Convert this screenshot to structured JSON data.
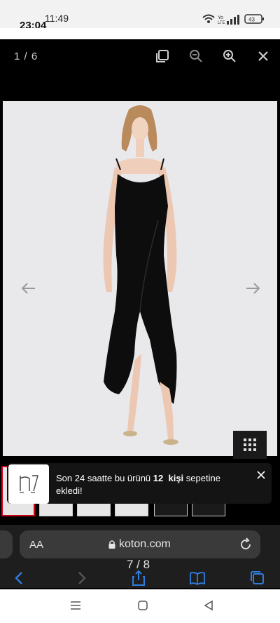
{
  "status": {
    "outer_time": "11:49",
    "inner_time": "23:04",
    "battery": "43",
    "network": "Yo LTE"
  },
  "viewer": {
    "counter": "1 / 6",
    "tools": [
      "copy-icon",
      "zoom-out-icon",
      "zoom-in-icon",
      "close-icon"
    ]
  },
  "toast": {
    "text_before": "Son 24 saatte bu ürünü ",
    "count": "12",
    "word": "kişi",
    "text_after": " sepetine ekledi!"
  },
  "browser": {
    "aa_label": "AA",
    "url": "koton.com",
    "page_indicator": "7 / 8"
  },
  "colors": {
    "background": "#000000",
    "photo_bg": "#e9e9ec",
    "dress": "#0d0d0d",
    "browser_bar": "#1e1e1e",
    "accent_blue": "#2f7de1"
  }
}
